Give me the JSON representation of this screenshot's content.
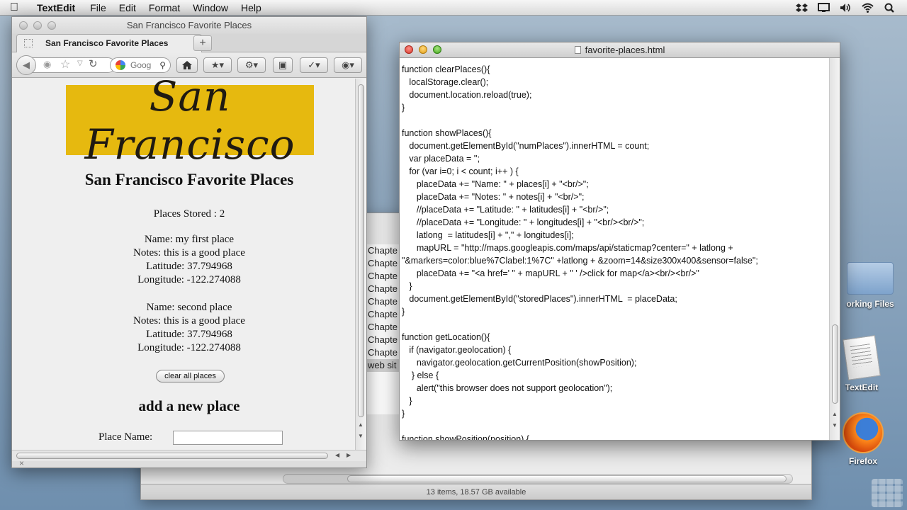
{
  "menubar": {
    "app_name": "TextEdit",
    "items": [
      "File",
      "Edit",
      "Format",
      "Window",
      "Help"
    ]
  },
  "finder": {
    "list_items": [
      "Chapte",
      "Chapte",
      "Chapte",
      "Chapte",
      "Chapte",
      "Chapte",
      "Chapte",
      "Chapte",
      "Chapte",
      "web sit"
    ],
    "status": "13 items, 18.57 GB available"
  },
  "desktop": {
    "icons": [
      {
        "label": "orking Files"
      },
      {
        "label": "TextEdit"
      },
      {
        "label": "Firefox"
      }
    ]
  },
  "browser": {
    "window_title": "San Francisco Favorite Places",
    "tab_title": "San Francisco Favorite Places",
    "new_tab": "+",
    "search_text": "Goog",
    "page": {
      "banner_text": "San Francisco",
      "heading": "San Francisco Favorite Places",
      "places_stored_label": "Places Stored : 2",
      "places": [
        {
          "name": "Name: my first place",
          "notes": "Notes: this is a good place",
          "latitude": "Latitude: 37.794968",
          "longitude": "Longitude: -122.274088"
        },
        {
          "name": "Name: second place",
          "notes": "Notes: this is a good place",
          "latitude": "Latitude: 37.794968",
          "longitude": "Longitude: -122.274088"
        }
      ],
      "clear_button": "clear all places",
      "add_heading": "add a new place",
      "place_name_label": "Place Name:",
      "place_name_value": ""
    }
  },
  "editor": {
    "window_title": "favorite-places.html",
    "code": "function clearPlaces(){\n\tlocalStorage.clear();\n\tdocument.location.reload(true);\n}\n\nfunction showPlaces(){\n\tdocument.getElementById(\"numPlaces\").innerHTML = count;\n\tvar placeData = '';\n\tfor (var i=0; i < count; i++ ) {\n\t\tplaceData += \"Name: \" + places[i] + \"<br/>\";\n\t\tplaceData += \"Notes: \" + notes[i] + \"<br/>\";\n\t\t//placeData += \"Latitude: \" + latitudes[i] + \"<br/>\";\n\t\t//placeData += \"Longitude: \" + longitudes[i] + \"<br/><br/>\";\n\t\tlatlong  = latitudes[i] + \",\" + longitudes[i];\n\t\tmapURL = \"http://maps.googleapis.com/maps/api/staticmap?center=\" + latlong +\n\"&markers=color:blue%7Clabel:1%7C\" +latlong + &zoom=14&size300x400&sensor=false\";\n\t\tplaceData += \"<a href=' \" + mapURL + \" ' />click for map</a><br/><br/>\"\n\t}\n\tdocument.getElementById(\"storedPlaces\").innerHTML  = placeData;\n}\n\nfunction getLocation(){\n\tif (navigator.geolocation) {\n\t\tnavigator.geolocation.getCurrentPosition(showPosition);\n\t } else {\n\t\talert(\"this browser does not support geolocation\");\n\t}\n}\n\nfunction showPosition(position) {"
  }
}
